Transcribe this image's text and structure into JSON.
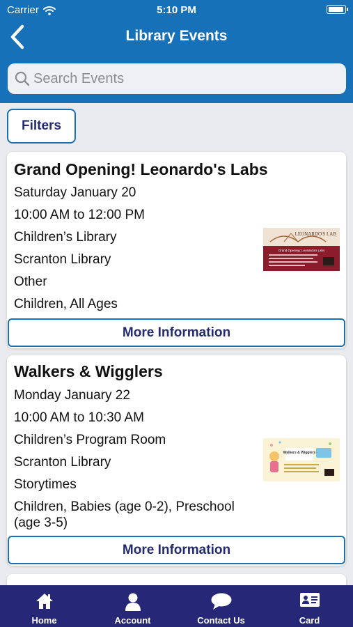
{
  "status_bar": {
    "carrier": "Carrier",
    "time": "5:10 PM",
    "battery_level": 0.95
  },
  "header": {
    "title": "Library Events"
  },
  "search": {
    "placeholder": "Search Events",
    "value": ""
  },
  "filters_label": "Filters",
  "events": [
    {
      "title": "Grand Opening! Leonardo's Labs",
      "date": "Saturday January 20",
      "time": "10:00 AM to 12:00 PM",
      "location": "Children’s Library",
      "branch": "Scranton Library",
      "category": "Other",
      "audience": "Children, All Ages",
      "thumbnail": {
        "heading": "LEONARDO'S LAB",
        "subheading": "Grand Opening: Leonardo's Labs"
      },
      "more_label": "More Information"
    },
    {
      "title": "Walkers & Wigglers",
      "date": "Monday January 22",
      "time": "10:00 AM to 10:30 AM",
      "location": "Children’s Program Room",
      "branch": "Scranton Library",
      "category": "Storytimes",
      "audience": "Children, Babies (age 0-2), Preschool (age 3-5)",
      "thumbnail": {
        "heading": "Walkers & Wigglers"
      },
      "more_label": "More Information"
    }
  ],
  "tabbar": {
    "tabs": [
      {
        "label": "Home",
        "icon": "home-icon"
      },
      {
        "label": "Account",
        "icon": "person-icon"
      },
      {
        "label": "Contact Us",
        "icon": "chat-bubble-icon"
      },
      {
        "label": "Card",
        "icon": "id-card-icon"
      }
    ]
  },
  "colors": {
    "header": "#1771b8",
    "tabbar": "#262776",
    "button_text": "#232a6e"
  }
}
